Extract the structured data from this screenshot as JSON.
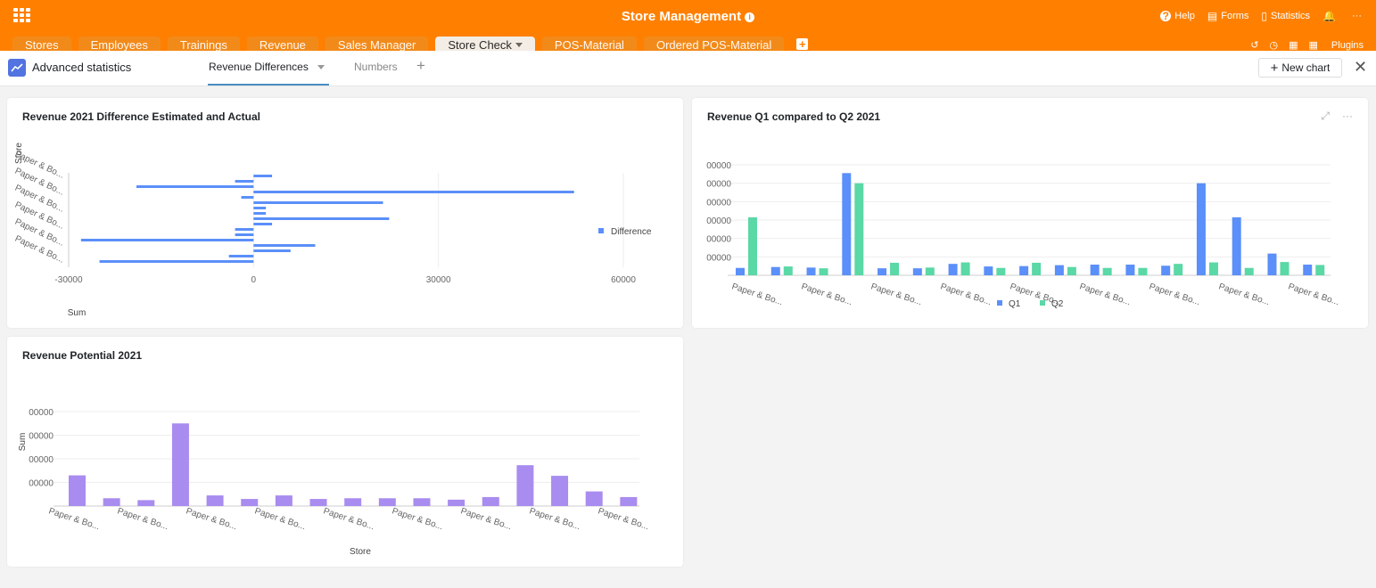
{
  "app": {
    "title": "Store Management",
    "help": "Help",
    "forms": "Forms",
    "statistics": "Statistics",
    "plugins": "Plugins",
    "more": "···"
  },
  "tabs": [
    "Stores",
    "Employees",
    "Trainings",
    "Revenue",
    "Sales Manager",
    "Store Check",
    "POS-Material",
    "Ordered POS-Material"
  ],
  "active_tab_index": 5,
  "panel": {
    "title": "Advanced statistics",
    "views": [
      "Revenue Differences",
      "Numbers"
    ],
    "new_chart": "New chart",
    "close": "✕"
  },
  "colors": {
    "brand": "#ff8000",
    "q1": "#5b8ff9",
    "q2": "#5ad8a6",
    "difference": "#5b8ff9",
    "potential": "#a98cef"
  },
  "chart_data": [
    {
      "type": "bar",
      "orientation": "horizontal",
      "title": "Revenue 2021 Difference Estimated and Actual",
      "xlabel": "Sum",
      "ylabel": "Store",
      "category_label": "Paper & Bo...",
      "xlim": [
        -30000,
        60000
      ],
      "xticks": [
        "-30000",
        "0",
        "30000",
        "60000"
      ],
      "series": [
        {
          "name": "Difference",
          "values": [
            3000,
            -3000,
            -19000,
            52000,
            -2000,
            21000,
            2000,
            2000,
            22000,
            3000,
            -3000,
            -3000,
            -28000,
            10000,
            6000,
            -4000,
            -25000
          ]
        }
      ],
      "legend": "right"
    },
    {
      "type": "bar",
      "title": "Revenue Q1 compared to Q2 2021",
      "category_label": "Paper & Bo...",
      "yticks": [
        "0",
        "00000",
        "00000",
        "00000",
        "00000",
        "00000",
        "00000"
      ],
      "ylim": [
        0,
        600000
      ],
      "series": [
        {
          "name": "Q1",
          "values": [
            40000,
            45000,
            42000,
            555000,
            38000,
            38000,
            62000,
            48000,
            50000,
            55000,
            58000,
            58000,
            52000,
            500000,
            315000,
            118000,
            58000
          ]
        },
        {
          "name": "Q2",
          "values": [
            315000,
            48000,
            38000,
            500000,
            68000,
            42000,
            70000,
            40000,
            68000,
            45000,
            40000,
            40000,
            62000,
            70000,
            40000,
            72000,
            56000
          ]
        }
      ],
      "legend": "bottom"
    },
    {
      "type": "bar",
      "title": "Revenue Potential 2021",
      "xlabel": "Store",
      "ylabel": "Sum",
      "category_label": "Paper & Bo...",
      "yticks": [
        "0",
        "00000",
        "00000",
        "00000",
        "00000"
      ],
      "ylim": [
        0,
        400000
      ],
      "series": [
        {
          "name": "",
          "values": [
            130000,
            33000,
            25000,
            350000,
            45000,
            30000,
            45000,
            30000,
            33000,
            33000,
            33000,
            27000,
            38000,
            173000,
            128000,
            62000,
            38000
          ]
        }
      ]
    }
  ]
}
